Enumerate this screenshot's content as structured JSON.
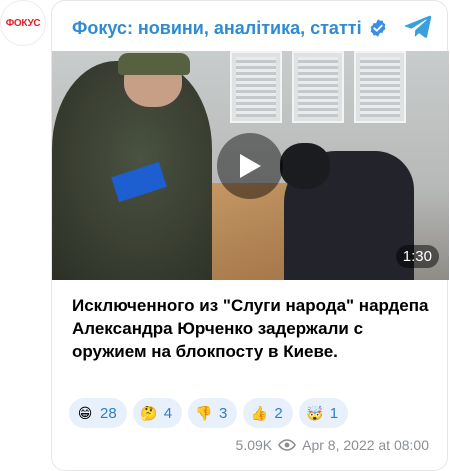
{
  "avatar": {
    "logo_text": "ФОКУС"
  },
  "header": {
    "channel_name": "Фокус: новини, аналітика, статті"
  },
  "video": {
    "duration": "1:30"
  },
  "post": {
    "text": "Исключенного из \"Слуги народа\" нардепа Александра Юрченко задержали с оружием на блокпосту в Киеве."
  },
  "reactions": [
    {
      "emoji": "😁",
      "count": "28"
    },
    {
      "emoji": "🤔",
      "count": "4"
    },
    {
      "emoji": "👎",
      "count": "3"
    },
    {
      "emoji": "👍",
      "count": "2"
    },
    {
      "emoji": "🤯",
      "count": "1"
    }
  ],
  "meta": {
    "views": "5.09K",
    "date": "Apr 8, 2022 at 08:00"
  },
  "colors": {
    "accent": "#2f8bd3",
    "reaction_bg": "#e8f1fb",
    "logo_red": "#e0202a"
  },
  "icons": [
    "verified-icon",
    "telegram-icon",
    "play-icon",
    "eye-icon"
  ]
}
